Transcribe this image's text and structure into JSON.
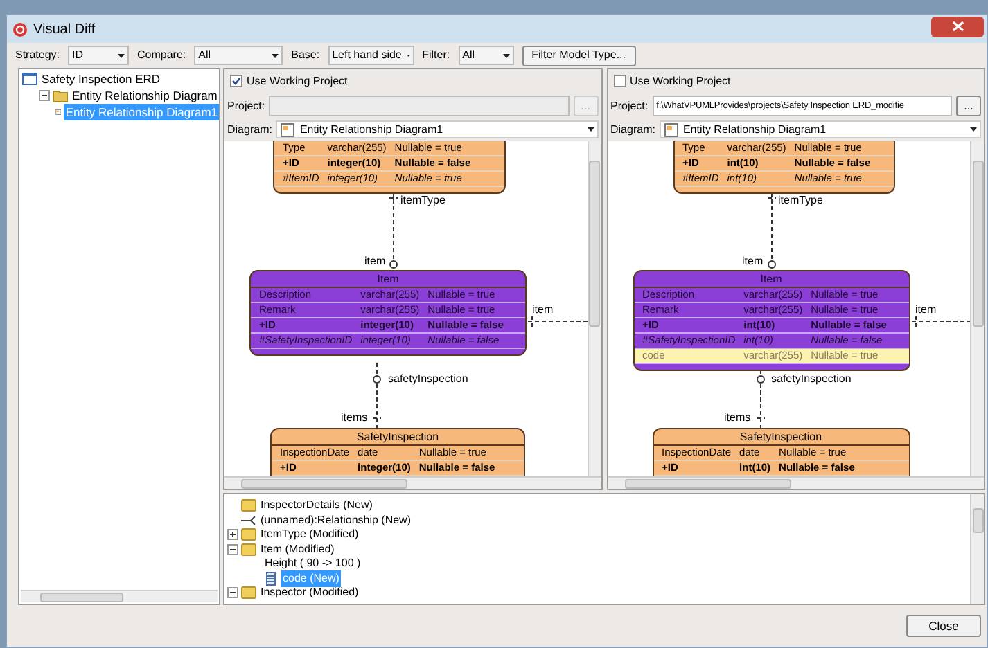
{
  "window": {
    "title": "Visual Diff"
  },
  "toolbar": {
    "fields": [
      {
        "label": "Strategy:",
        "value": "ID"
      },
      {
        "label": "Compare:",
        "value": "All"
      },
      {
        "label": "Base:",
        "value": "Left hand side"
      },
      {
        "label": "Filter:",
        "value": "All"
      }
    ],
    "button": "Filter Model Type..."
  },
  "model_tree": [
    {
      "label": "Safety Inspection ERD",
      "kind": "project",
      "selected": false,
      "children": [
        {
          "label": "Entity Relationship Diagram",
          "kind": "folder",
          "expanded": true,
          "selected": false,
          "children": [
            {
              "label": "Entity Relationship Diagram1",
              "kind": "diagram",
              "selected": true
            }
          ]
        }
      ]
    }
  ],
  "panes": [
    {
      "use_working_project": {
        "label": "Use Working Project",
        "checked": true
      },
      "project": {
        "label": "Project:",
        "disabled": true
      },
      "browse": "...",
      "diagram": {
        "label": "Diagram:",
        "value": "Entity Relationship Diagram1"
      },
      "entities": [
        {
          "color": "#f7b87c",
          "rows": [
            {
              "kind": "plain",
              "name": "Type",
              "type": "varchar(255)",
              "nullable": "Nullable = true"
            },
            {
              "kind": "pk",
              "name": "+ID",
              "type": "integer(10)",
              "nullable": "Nullable = false"
            },
            {
              "kind": "fk",
              "name": "#ItemID",
              "type": "integer(10)",
              "nullable": "Nullable = true"
            }
          ]
        },
        {
          "name": "Item",
          "color": "#8c3fd6",
          "rows": [
            {
              "kind": "plain",
              "name": "Description",
              "type": "varchar(255)",
              "nullable": "Nullable = true"
            },
            {
              "kind": "plain",
              "name": "Remark",
              "type": "varchar(255)",
              "nullable": "Nullable = true"
            },
            {
              "kind": "pk",
              "name": "+ID",
              "type": "integer(10)",
              "nullable": "Nullable = false"
            },
            {
              "kind": "fk",
              "name": "#SafetyInspectionID",
              "type": "integer(10)",
              "nullable": "Nullable = false"
            }
          ]
        },
        {
          "name": "SafetyInspection",
          "color": "#f7b87c",
          "rows": [
            {
              "kind": "plain",
              "name": "InspectionDate",
              "type": "date",
              "nullable": "Nullable = true"
            },
            {
              "kind": "pk",
              "name": "+ID",
              "type": "integer(10)",
              "nullable": "Nullable = false"
            }
          ]
        }
      ],
      "connectors": [
        {
          "labels": [
            "itemType",
            "item"
          ]
        },
        {
          "labels": [
            "item"
          ]
        },
        {
          "labels": [
            "safetyInspection",
            "items"
          ]
        }
      ]
    },
    {
      "use_working_project": {
        "label": "Use Working Project",
        "checked": false
      },
      "project": {
        "label": "Project:",
        "value": "f:\\WhatVPUMLProvides\\projects\\Safety Inspection ERD_modifie",
        "disabled": false
      },
      "browse": "...",
      "diagram": {
        "label": "Diagram:",
        "value": "Entity Relationship Diagram1"
      },
      "entities": [
        {
          "color": "#f7b87c",
          "rows": [
            {
              "kind": "plain",
              "name": "Type",
              "type": "varchar(255)",
              "nullable": "Nullable = true"
            },
            {
              "kind": "pk",
              "name": "+ID",
              "type": "int(10)",
              "nullable": "Nullable = false"
            },
            {
              "kind": "fk",
              "name": "#ItemID",
              "type": "int(10)",
              "nullable": "Nullable = true"
            }
          ]
        },
        {
          "name": "Item",
          "color": "#8c3fd6",
          "rows": [
            {
              "kind": "plain",
              "name": "Description",
              "type": "varchar(255)",
              "nullable": "Nullable = true"
            },
            {
              "kind": "plain",
              "name": "Remark",
              "type": "varchar(255)",
              "nullable": "Nullable = true"
            },
            {
              "kind": "pk",
              "name": "+ID",
              "type": "int(10)",
              "nullable": "Nullable = false"
            },
            {
              "kind": "fk",
              "name": "#SafetyInspectionID",
              "type": "int(10)",
              "nullable": "Nullable = false"
            },
            {
              "kind": "new",
              "name": "code",
              "type": "varchar(255)",
              "nullable": "Nullable = true"
            }
          ]
        },
        {
          "name": "SafetyInspection",
          "color": "#f7b87c",
          "rows": [
            {
              "kind": "plain",
              "name": "InspectionDate",
              "type": "date",
              "nullable": "Nullable = true"
            },
            {
              "kind": "pk",
              "name": "+ID",
              "type": "int(10)",
              "nullable": "Nullable = false"
            }
          ]
        }
      ],
      "connectors": [
        {
          "labels": [
            "itemType",
            "item"
          ]
        },
        {
          "labels": [
            "item"
          ]
        },
        {
          "labels": [
            "safetyInspection",
            "items"
          ]
        }
      ]
    }
  ],
  "changes": [
    {
      "label": "InspectorDetails (New)",
      "kind": "entity",
      "selected": false
    },
    {
      "label": "(unnamed):Relationship (New)",
      "kind": "relationship",
      "selected": false
    },
    {
      "label": "ItemType (Modified)",
      "kind": "entity",
      "expanded": false,
      "selected": false
    },
    {
      "label": "Item (Modified)",
      "kind": "entity",
      "expanded": true,
      "selected": false,
      "children": [
        {
          "label": "Height ( 90 -> 100 )",
          "kind": "property",
          "selected": false
        },
        {
          "label": "code (New)",
          "kind": "column",
          "selected": true
        }
      ]
    },
    {
      "label": "Inspector (Modified)",
      "kind": "entity",
      "expanded": true,
      "selected": false
    }
  ],
  "close_button": "Close"
}
